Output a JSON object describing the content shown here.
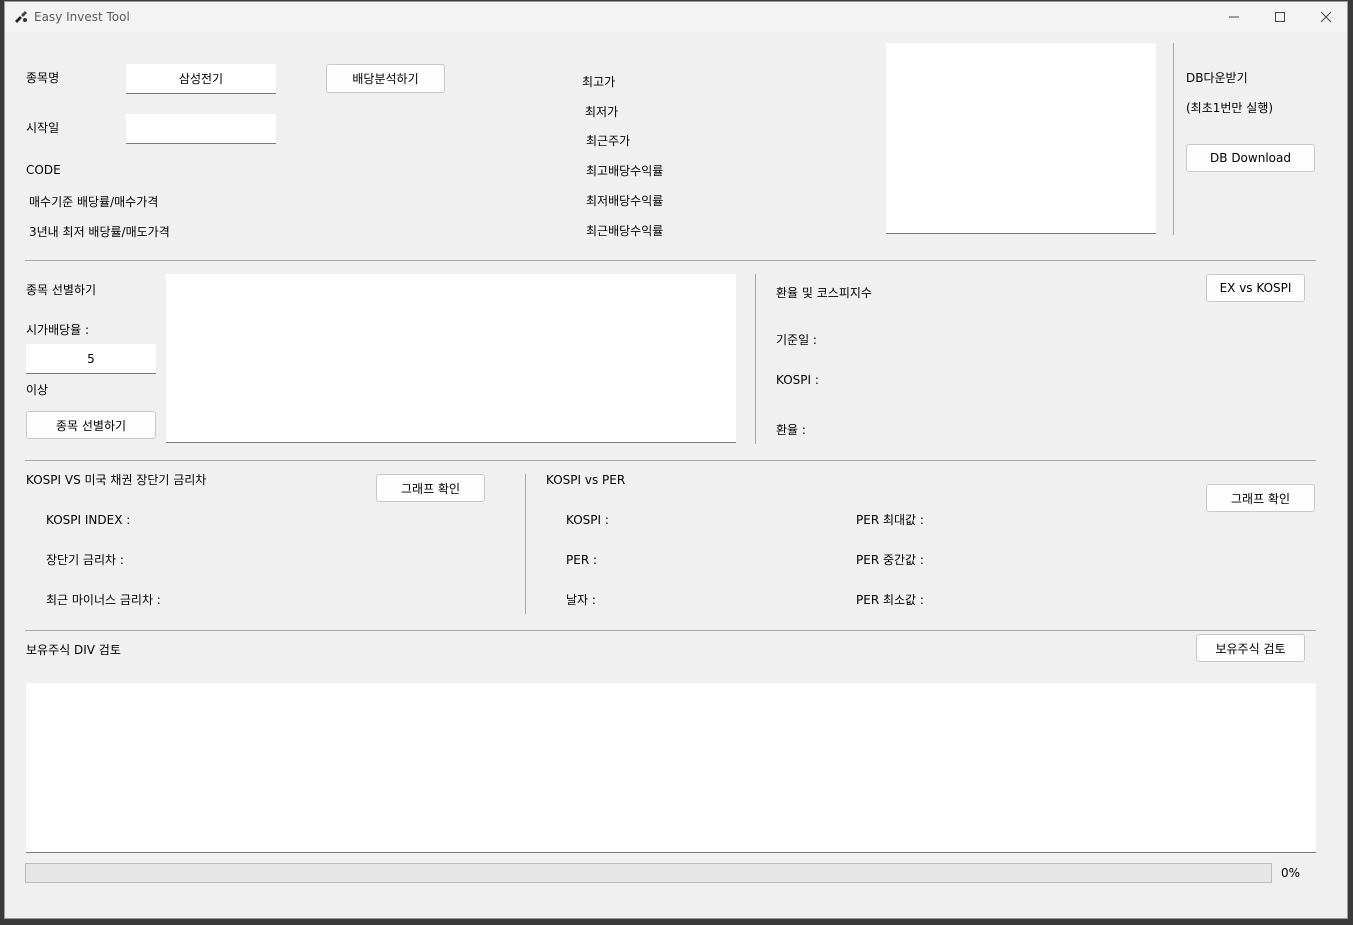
{
  "window": {
    "title": "Easy Invest Tool"
  },
  "stock": {
    "name_label": "종목명",
    "name_value": "삼성전기",
    "start_label": "시작일",
    "start_value": "",
    "code_label": "CODE",
    "buy_label": "매수기준 배당률/매수가격",
    "sell_label": "3년내 최저 배당률/매도가격",
    "analyze_button": "배당분석하기",
    "stats": {
      "high": "최고가",
      "low": "최저가",
      "recent": "최근주가",
      "high_yield": "최고배당수익률",
      "low_yield": "최저배당수익률",
      "recent_yield": "최근배당수익률"
    }
  },
  "db": {
    "title": "DB다운받기",
    "note": "(최초1번만 실행)",
    "button": "DB Download"
  },
  "screen": {
    "title": "종목 선별하기",
    "yield_label": "시가배당율 :",
    "yield_value": "5",
    "above_label": "이상",
    "button": "종목 선별하기"
  },
  "fx": {
    "title": "환율 및 코스피지수",
    "button": "EX vs KOSPI",
    "date_label": "기준일 :",
    "kospi_label": "KOSPI :",
    "rate_label": "환율 :"
  },
  "bond": {
    "title": "KOSPI VS 미국 채권 장단기 금리차",
    "button": "그래프 확인",
    "kospi_index": "KOSPI INDEX :",
    "spread": "장단기 금리차 :",
    "neg_spread": "최근 마이너스 금리차 :"
  },
  "per": {
    "title": "KOSPI vs PER",
    "button": "그래프 확인",
    "kospi": "KOSPI :",
    "per": "PER :",
    "date": "날자 :",
    "per_max": "PER 최대값 :",
    "per_mid": "PER 중간값 :",
    "per_min": "PER 최소값 :"
  },
  "holdings": {
    "title": "보유주식 DIV 검토",
    "button": "보유주식 검토"
  },
  "progress": {
    "value": 0,
    "text": "0%"
  }
}
